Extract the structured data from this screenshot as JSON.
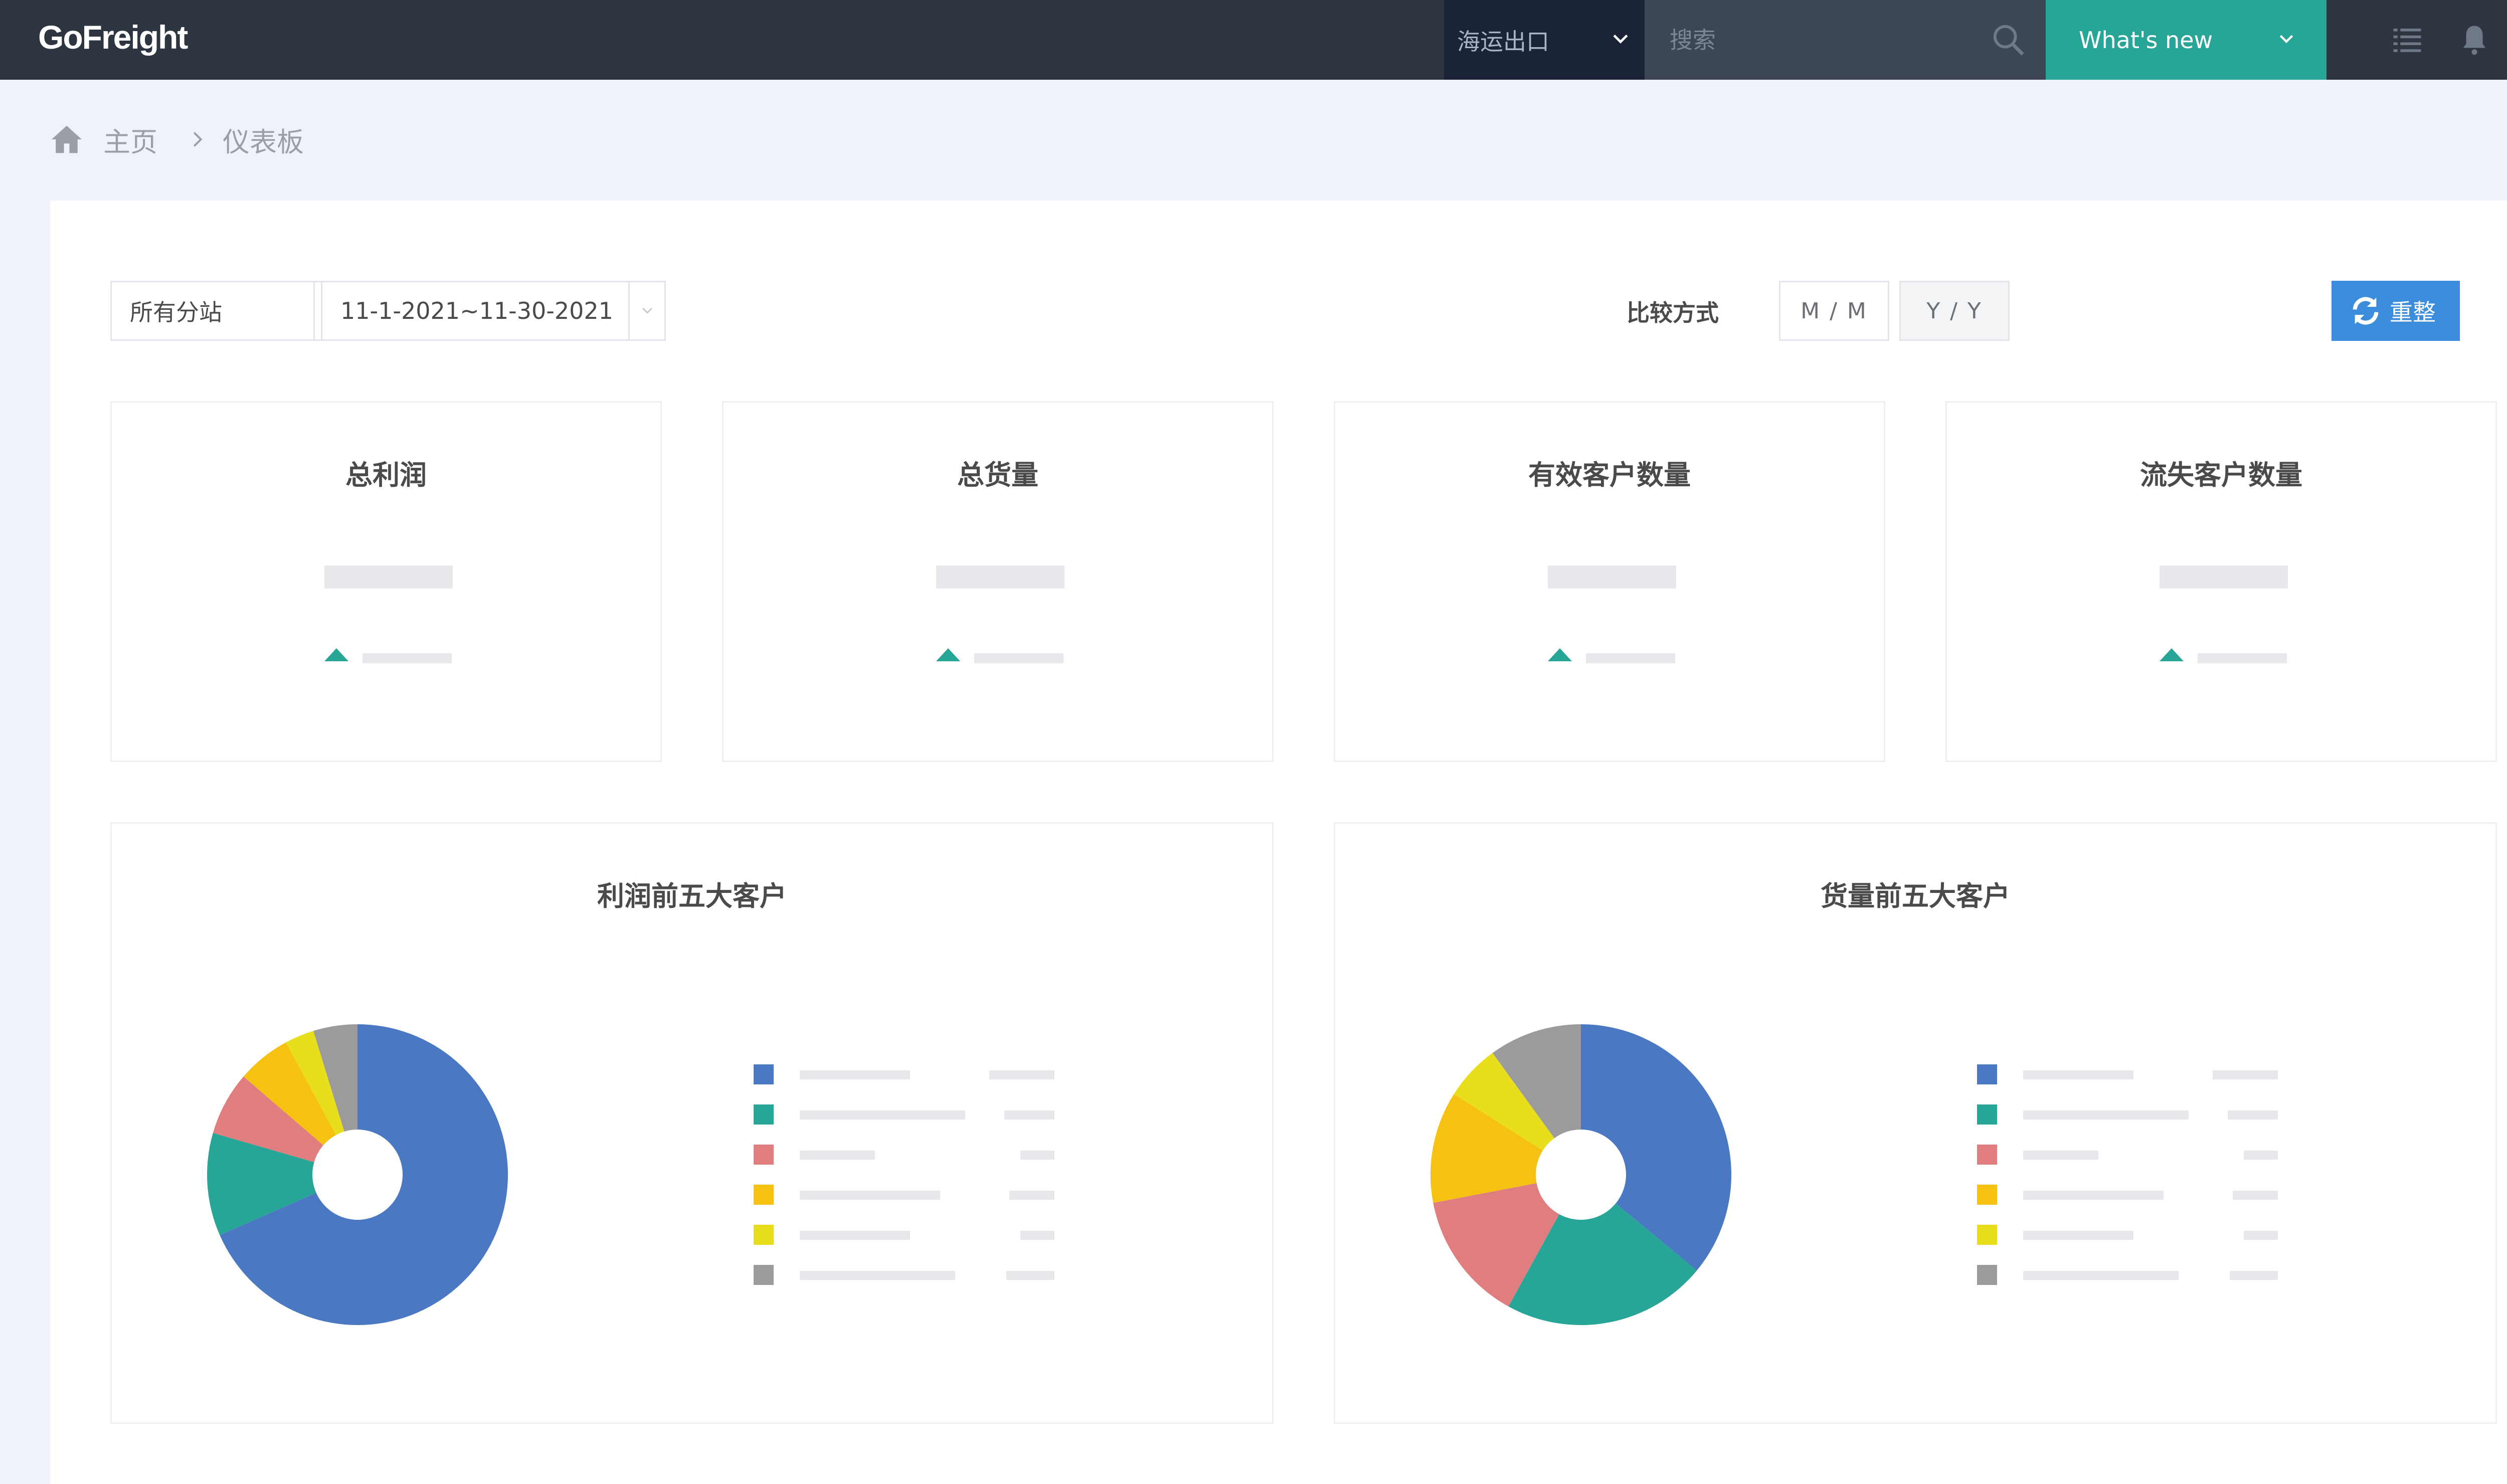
{
  "app": {
    "logo": "GoFreight"
  },
  "topbar": {
    "module_label": "海运出口",
    "search_placeholder": "搜索",
    "whats_new_label": "What's new",
    "icons": [
      "list-icon",
      "bell-icon",
      "user-account-icon"
    ]
  },
  "breadcrumb": {
    "home_label": "主页",
    "current_label": "仪表板"
  },
  "filters": {
    "branch_value": "所有分站",
    "date_range_value": "11-1-2021~11-30-2021",
    "compare_label": "比较方式",
    "compare_options": [
      "M / M",
      "Y / Y"
    ],
    "compare_selected": "Y / Y",
    "reset_label": "重整"
  },
  "kpis": [
    {
      "title": "总利润"
    },
    {
      "title": "总货量"
    },
    {
      "title": "有效客户数量"
    },
    {
      "title": "流失客户数量"
    }
  ],
  "colors": {
    "topbar_bg": "#2d3541",
    "module_bg": "#1b2436",
    "accent_teal": "#27a596",
    "button_blue": "#3b8ddb",
    "series": [
      "#4a78c2",
      "#27a596",
      "#e07d7f",
      "#f5c211",
      "#e8de1c",
      "#9b9b9b"
    ]
  },
  "charts": [
    {
      "title": "利润前五大客户",
      "chart_data": {
        "type": "pie",
        "title": "利润前五大客户",
        "values": [
          65,
          10.5,
          6.5,
          5.5,
          3,
          4.5
        ],
        "colors": [
          "#4a78c2",
          "#27a596",
          "#e07d7f",
          "#f5c211",
          "#e8de1c",
          "#9b9b9b"
        ]
      },
      "legend_bars": [
        [
          220,
          130
        ],
        [
          330,
          100
        ],
        [
          150,
          68
        ],
        [
          280,
          90
        ],
        [
          220,
          68
        ],
        [
          310,
          96
        ]
      ]
    },
    {
      "title": "货量前五大客户",
      "chart_data": {
        "type": "pie",
        "title": "货量前五大客户",
        "values": [
          36,
          22,
          14,
          12,
          6,
          10
        ],
        "colors": [
          "#4a78c2",
          "#27a596",
          "#e07d7f",
          "#f5c211",
          "#e8de1c",
          "#9b9b9b"
        ]
      },
      "legend_bars": [
        [
          220,
          130
        ],
        [
          330,
          100
        ],
        [
          150,
          68
        ],
        [
          280,
          90
        ],
        [
          220,
          68
        ],
        [
          310,
          96
        ]
      ]
    }
  ]
}
